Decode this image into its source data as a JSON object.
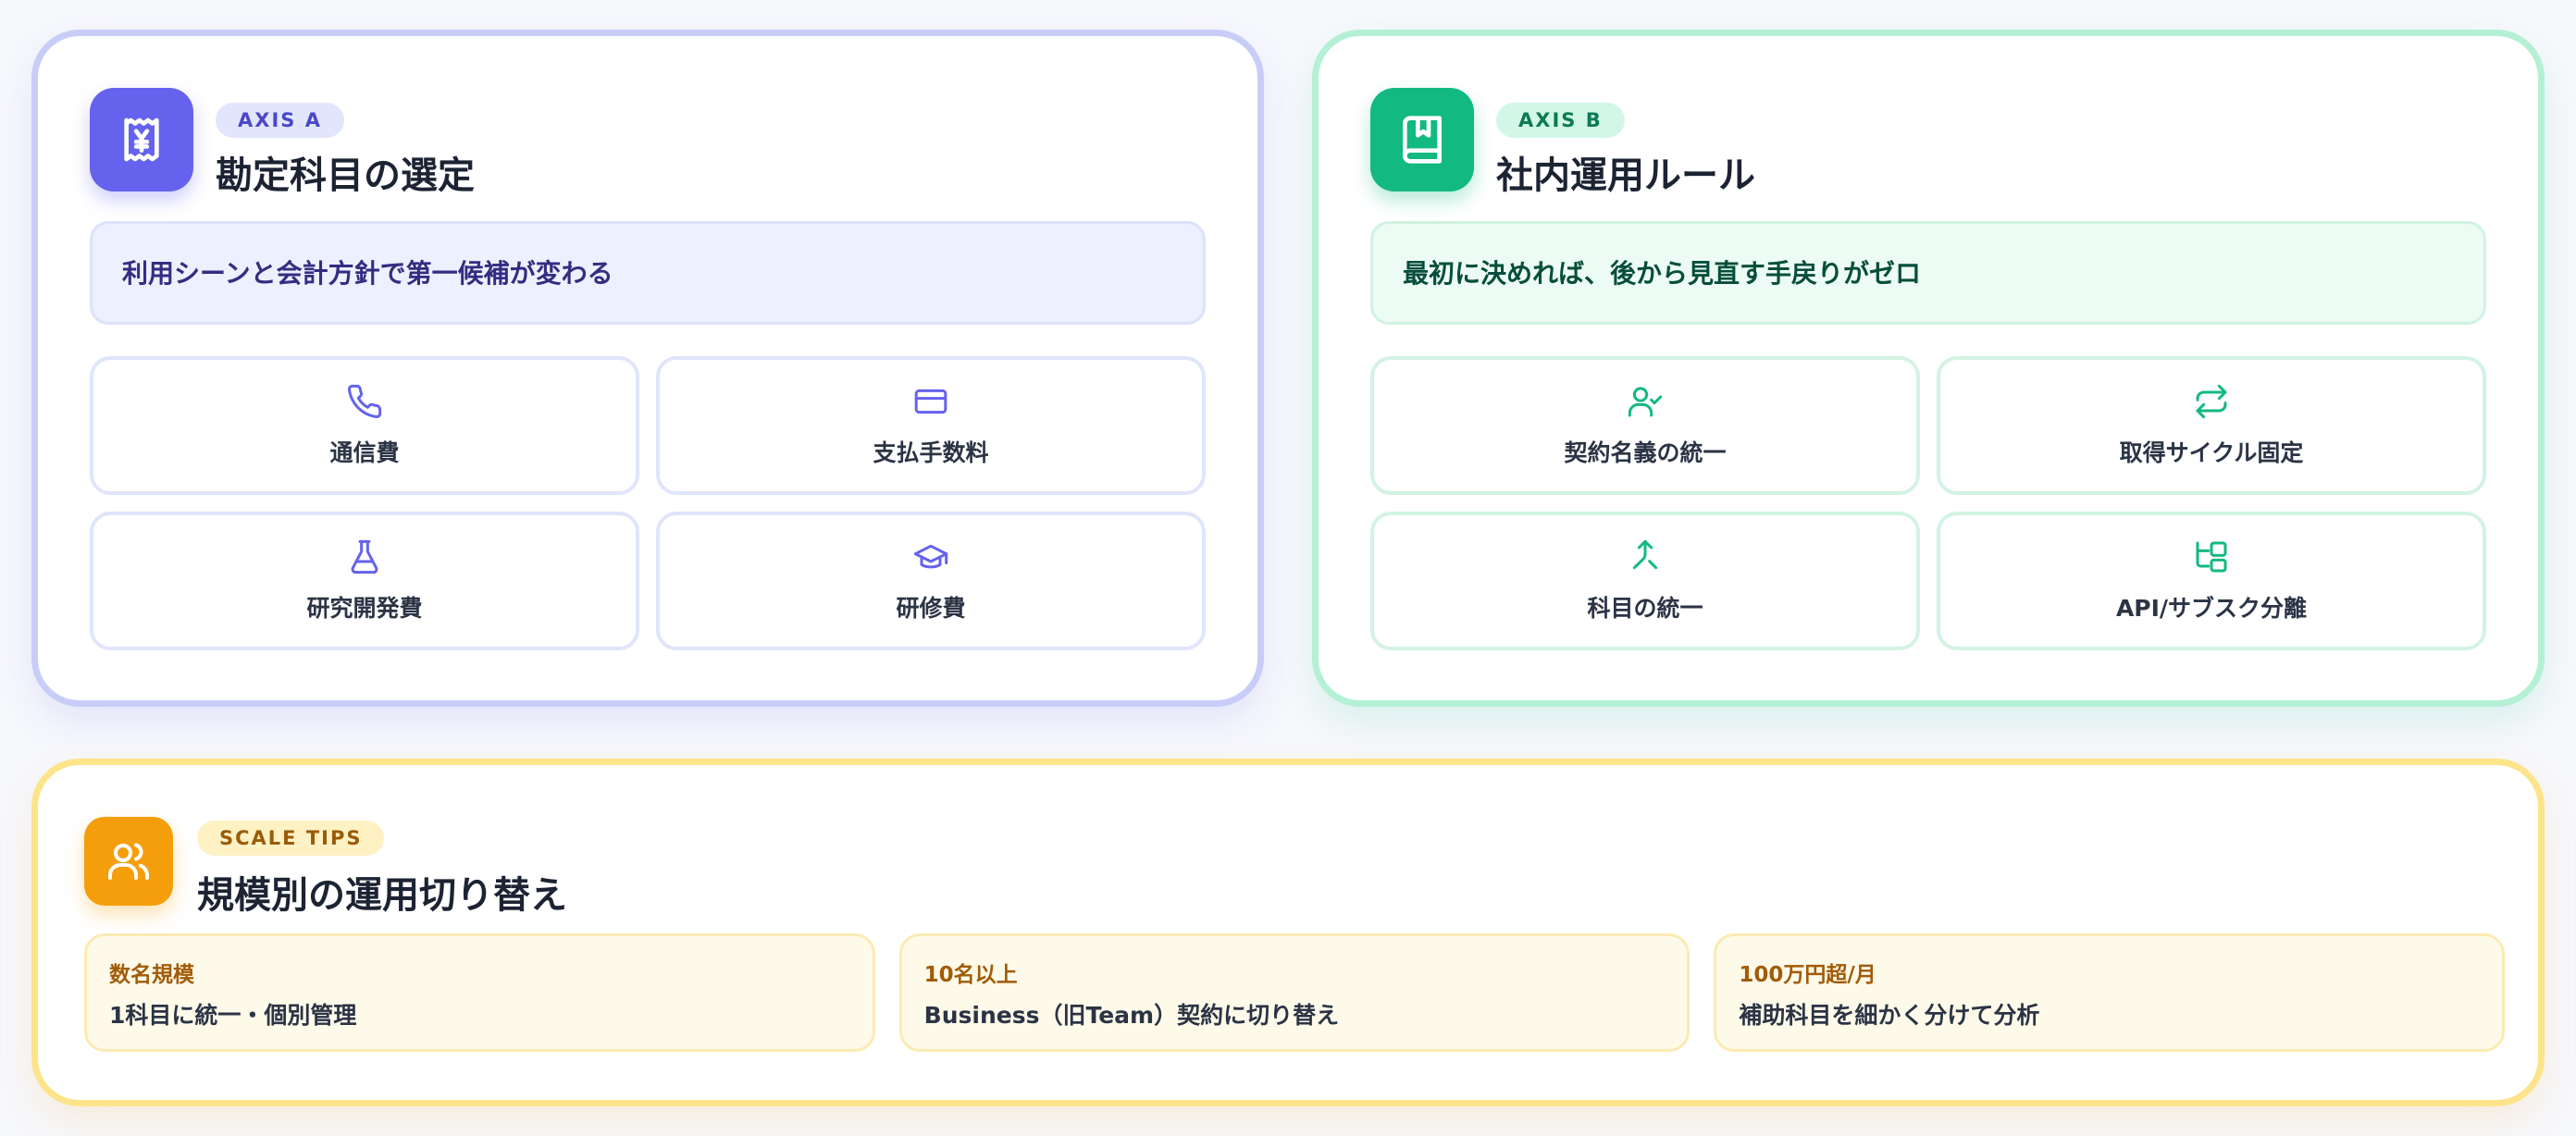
{
  "axis_a": {
    "tag": "AXIS A",
    "title": "勘定科目の選定",
    "banner": "利用シーンと会計方針で第一候補が変わる",
    "icon": "receipt-yen-icon",
    "accent": "#6562ee",
    "tiles": [
      {
        "label": "通信費",
        "icon": "phone-icon"
      },
      {
        "label": "支払手数料",
        "icon": "credit-card-icon"
      },
      {
        "label": "研究開発費",
        "icon": "flask-icon"
      },
      {
        "label": "研修費",
        "icon": "graduation-cap-icon"
      }
    ]
  },
  "axis_b": {
    "tag": "AXIS B",
    "title": "社内運用ルール",
    "banner": "最初に決めれば、後から見直す手戻りがゼロ",
    "icon": "bookmark-book-icon",
    "accent": "#12b981",
    "tiles": [
      {
        "label": "契約名義の統一",
        "icon": "user-check-icon"
      },
      {
        "label": "取得サイクル固定",
        "icon": "repeat-icon"
      },
      {
        "label": "科目の統一",
        "icon": "merge-icon"
      },
      {
        "label": "API/サブスク分離",
        "icon": "folder-tree-icon"
      }
    ]
  },
  "scale": {
    "tag": "SCALE TIPS",
    "title": "規模別の運用切り替え",
    "icon": "users-icon",
    "accent": "#f59e0b",
    "tips": [
      {
        "head": "数名規模",
        "body": "1科目に統一・個別管理"
      },
      {
        "head": "10名以上",
        "body": "Business（旧Team）契約に切り替え"
      },
      {
        "head": "100万円超/月",
        "body": "補助科目を細かく分けて分析"
      }
    ]
  }
}
